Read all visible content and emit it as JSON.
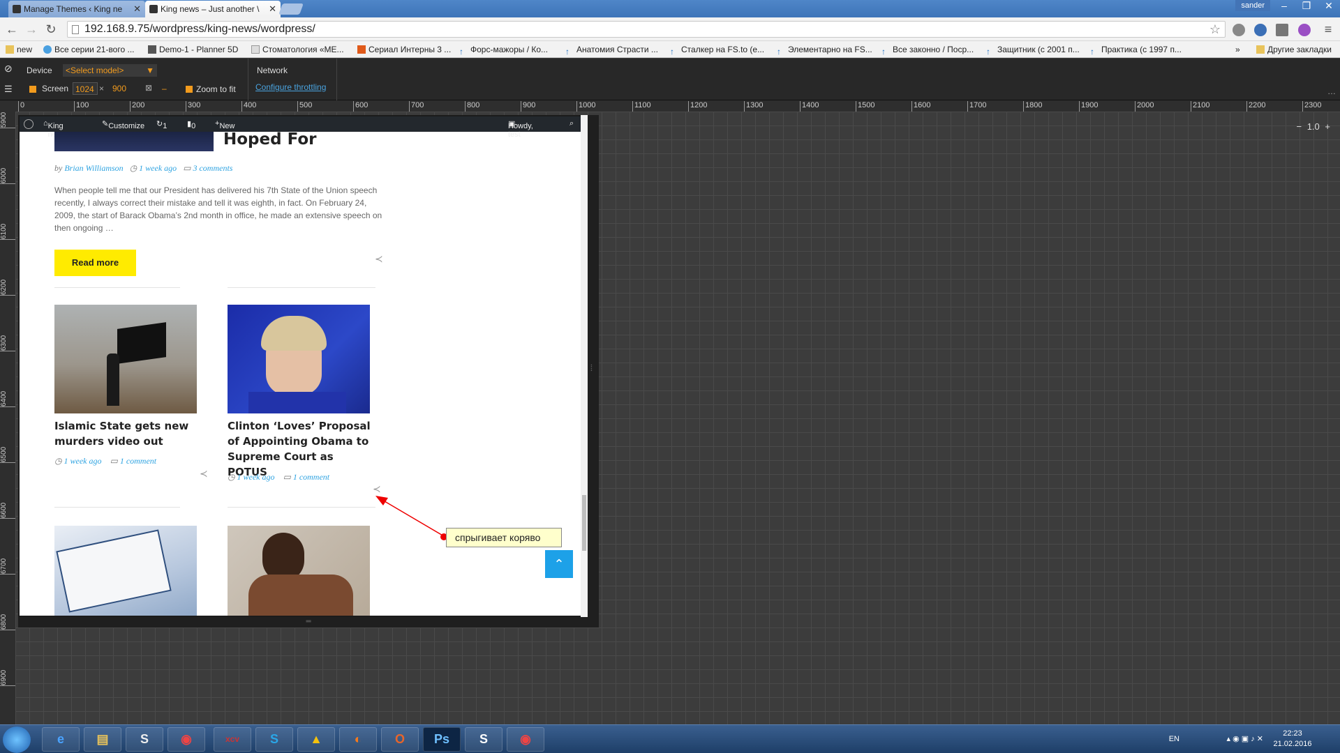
{
  "browser": {
    "tabs": [
      {
        "title": "Manage Themes ‹ King ne",
        "active": false
      },
      {
        "title": "King news – Just another \\",
        "active": true
      }
    ],
    "user": "sander",
    "url": "192.168.9.75/wordpress/king-news/wordpress/",
    "bookmarks": [
      "new",
      "Все серии 21-вого ...",
      "Demo-1 - Planner 5D",
      "Стоматология «МЕ...",
      "Сериал Интерны 3 ...",
      "Форс-мажоры / Ко...",
      "Анатомия Страсти ...",
      "Сталкер на FS.to (е...",
      "Элементарно на FS...",
      "Все законно / Поср...",
      "Защитник (с 2001 п...",
      "Практика (с 1997 п...",
      "»",
      "Другие закладки"
    ]
  },
  "devtools": {
    "device_label": "Device",
    "model_select": "<Select model>",
    "screen_label": "Screen",
    "width": "1024",
    "x": "×",
    "height": "900",
    "dash": "–",
    "zoom_label": "Zoom to fit",
    "network_label": "Network",
    "throttling_link": "Configure throttling",
    "zoom_value": "1.0",
    "minus": "−",
    "plus": "+",
    "ruler_h": [
      "0",
      "100",
      "200",
      "300",
      "400",
      "500",
      "600",
      "700",
      "800",
      "900",
      "1000",
      "1100",
      "1200",
      "1300",
      "1400",
      "1500",
      "1600",
      "1700",
      "1800",
      "1900",
      "2000",
      "2100",
      "2200",
      "2300"
    ],
    "ruler_v": [
      "5900",
      "6000",
      "6100",
      "6200",
      "6300",
      "6400",
      "6500",
      "6600",
      "6700",
      "6800",
      "6900"
    ]
  },
  "wp_admin_bar": {
    "site": "King news",
    "customize": "Customize",
    "updates": "1",
    "comments": "0",
    "new": "New",
    "howdy": "Howdy, test"
  },
  "page": {
    "featured_post": {
      "title_fragment": "Hoped For",
      "by": "by",
      "author": "Brian Williamson",
      "date": "1 week ago",
      "comments": "3 comments",
      "excerpt": "When people tell me that our President has delivered his 7th State of the Union speech recently, I always correct their mistake and tell it was eighth, in fact. On February 24, 2009, the start of Barack Obama’s 2nd month in office, he made an extensive speech on then ongoing …",
      "read_more": "Read more"
    },
    "cards": [
      {
        "title": "Islamic State gets new murders video out",
        "date": "1 week ago",
        "comments": "1 comment"
      },
      {
        "title": "Clinton ‘Loves’ Proposal of Appointing Obama to Supreme Court as POTUS",
        "date": "1 week ago",
        "comments": "1 comment"
      }
    ],
    "to_top": "⌃"
  },
  "annotation": {
    "text": "спрыгивает коряво",
    "color": "#e00000"
  },
  "taskbar": {
    "apps": [
      "ie",
      "explorer",
      "S",
      "chrome",
      "xcv",
      "skype",
      "drive",
      "firefox",
      "office",
      "Ps",
      "S",
      "chrome"
    ],
    "lang": "EN",
    "time": "22:23",
    "date": "21.02.2016"
  },
  "colors": {
    "accent_yellow": "#ffeb00",
    "link_blue": "#2ea3e1",
    "to_top_blue": "#1da1e8",
    "devtools_orange": "#f29b1d"
  }
}
